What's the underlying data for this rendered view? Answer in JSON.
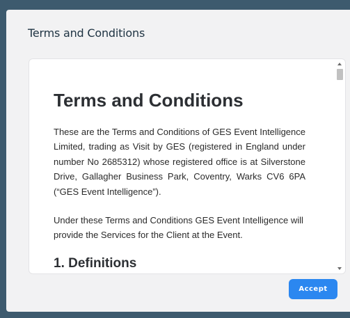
{
  "modal": {
    "title": "Terms and Conditions",
    "accept_label": "Accept"
  },
  "document": {
    "heading": "Terms and Conditions",
    "paragraphs": [
      "These are the Terms and Conditions of GES Event Intelligence Limited, trading as Visit by GES (registered in England under number No 2685312) whose registered office is at Silverstone Drive, Gallagher Business Park, Coventry, Warks CV6 6PA (“GES Event Intelligence”).",
      "Under these Terms and Conditions GES Event Intelligence will provide the Services for the Client at the Event."
    ],
    "section_heading": "1. Definitions"
  },
  "icons": {
    "scroll_up": "scroll-up-arrow-icon",
    "scroll_down": "scroll-down-arrow-icon"
  },
  "colors": {
    "backdrop": "#3d5a6e",
    "modal_background": "#f2f2f3",
    "accent": "#2b87f0",
    "title_text": "#1e3342"
  }
}
